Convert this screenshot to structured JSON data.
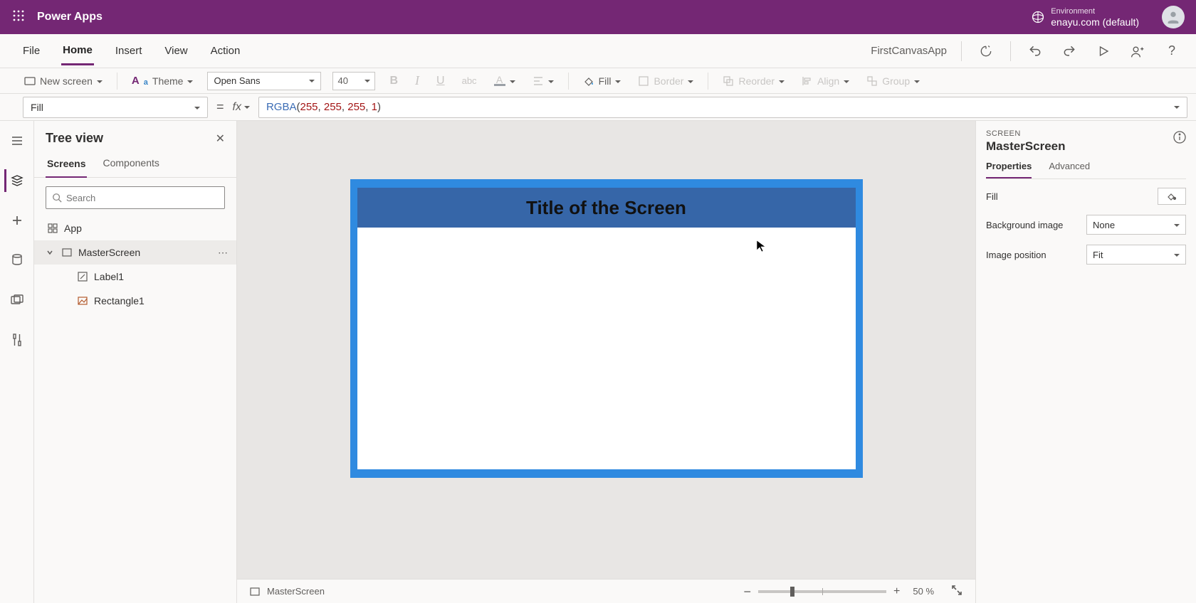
{
  "topbar": {
    "app_title": "Power Apps",
    "env_label": "Environment",
    "env_name": "enayu.com (default)"
  },
  "menu": {
    "items": [
      "File",
      "Home",
      "Insert",
      "View",
      "Action"
    ],
    "active_index": 1,
    "app_name": "FirstCanvasApp"
  },
  "ribbon": {
    "new_screen": "New screen",
    "theme": "Theme",
    "font_name": "Open Sans",
    "font_size": "40",
    "fill": "Fill",
    "border": "Border",
    "reorder": "Reorder",
    "align": "Align",
    "group": "Group"
  },
  "formula": {
    "property": "Fill",
    "fx": "fx",
    "fn": "RGBA",
    "args": [
      "255",
      "255",
      "255",
      "1"
    ]
  },
  "tree": {
    "title": "Tree view",
    "tabs": [
      "Screens",
      "Components"
    ],
    "active_tab": 0,
    "search_placeholder": "Search",
    "nodes": {
      "app": "App",
      "screen": "MasterScreen",
      "label": "Label1",
      "rect": "Rectangle1"
    }
  },
  "canvas": {
    "screen_title": "Title of the Screen"
  },
  "statusbar": {
    "screen_name": "MasterScreen",
    "zoom": "50",
    "zoom_suffix": "%"
  },
  "props": {
    "kind": "SCREEN",
    "name": "MasterScreen",
    "tabs": [
      "Properties",
      "Advanced"
    ],
    "active_tab": 0,
    "rows": {
      "fill_label": "Fill",
      "bg_label": "Background image",
      "bg_value": "None",
      "imgpos_label": "Image position",
      "imgpos_value": "Fit"
    }
  }
}
